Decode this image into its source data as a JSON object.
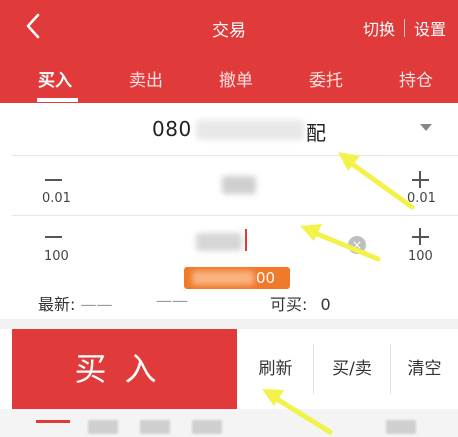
{
  "header": {
    "title": "交易",
    "switch_label": "切换",
    "settings_label": "设置",
    "tabs": [
      {
        "label": "买入",
        "active": true
      },
      {
        "label": "卖出",
        "active": false
      },
      {
        "label": "撤单",
        "active": false
      },
      {
        "label": "委托",
        "active": false
      },
      {
        "label": "持仓",
        "active": false
      }
    ]
  },
  "stock": {
    "code_visible": "080",
    "name_suffix": "配"
  },
  "price_row": {
    "minus_step": "0.01",
    "plus_step": "0.01",
    "minus_symbol": "—",
    "plus_symbol": "+"
  },
  "quantity_row": {
    "minus_step": "100",
    "plus_step": "100",
    "clear_symbol": "×",
    "hint_tail": "00"
  },
  "info": {
    "latest_label": "最新:",
    "latest_value": "——",
    "latest_change": "——",
    "available_label": "可买:",
    "available_value": "0"
  },
  "actions": {
    "buy_label": "买入",
    "refresh_label": "刷新",
    "buy_sell_label": "买/卖",
    "clear_label": "清空"
  },
  "colors": {
    "brand_red": "#e03a3a",
    "hint_orange": "#f07a2a",
    "annotation_yellow": "#f2f24a"
  }
}
